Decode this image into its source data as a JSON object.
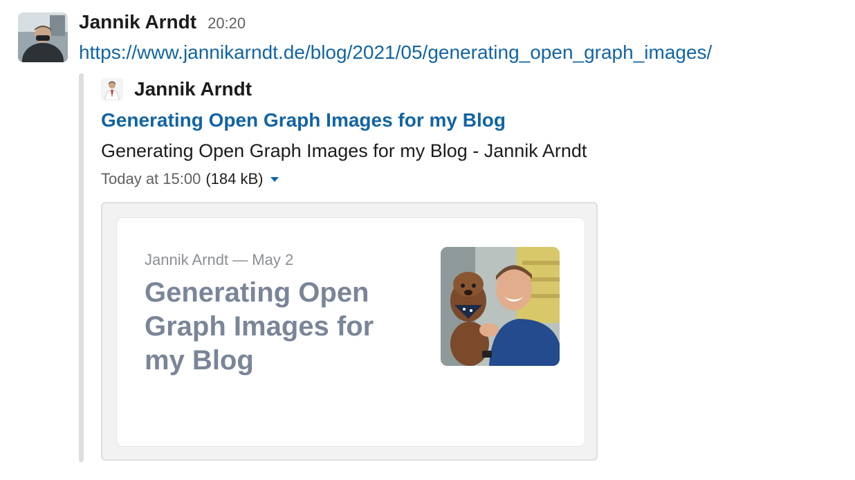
{
  "message": {
    "sender": "Jannik Arndt",
    "time": "20:20",
    "link": "https://www.jannikarndt.de/blog/2021/05/generating_open_graph_images/"
  },
  "attachment": {
    "service_name": "Jannik Arndt",
    "title": "Generating Open Graph Images for my Blog",
    "text": "Generating Open Graph Images for my Blog - Jannik Arndt",
    "timestamp": "Today at 15:00",
    "size": "(184 kB)",
    "colors": {
      "link": "#1264a3",
      "bar": "#dddddd",
      "og_heading": "#7a8598"
    }
  },
  "og_image": {
    "byline": "Jannik Arndt — May 2",
    "heading": "Generating Open Graph Images for my Blog"
  }
}
